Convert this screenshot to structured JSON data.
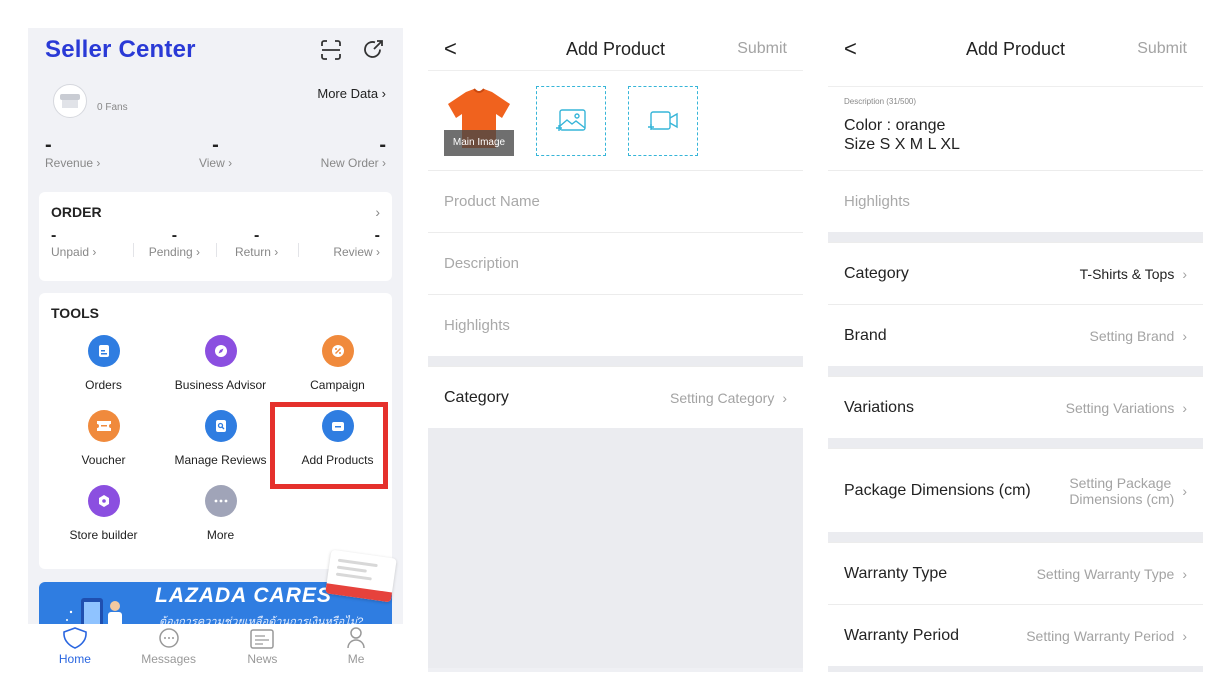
{
  "seller": {
    "title": "Seller Center",
    "fans": "0 Fans",
    "more_data": "More Data ›",
    "stats": [
      {
        "value": "-",
        "label": "Revenue ›"
      },
      {
        "value": "-",
        "label": "View ›"
      },
      {
        "value": "-",
        "label": "New Order ›"
      }
    ],
    "order": {
      "title": "ORDER",
      "chevron": "›",
      "items": [
        {
          "value": "-",
          "label": "Unpaid ›"
        },
        {
          "value": "-",
          "label": "Pending ›"
        },
        {
          "value": "-",
          "label": "Return ›"
        },
        {
          "value": "-",
          "label": "Review ›"
        }
      ]
    },
    "tools": {
      "title": "TOOLS",
      "items": [
        {
          "label": "Orders",
          "icon": "orders-icon",
          "color": "#2f7de1"
        },
        {
          "label": "Business Advisor",
          "icon": "compass-icon",
          "color": "#8b4fe0"
        },
        {
          "label": "Campaign",
          "icon": "percent-icon",
          "color": "#f08a3c"
        },
        {
          "label": "Voucher",
          "icon": "ticket-icon",
          "color": "#f08a3c"
        },
        {
          "label": "Manage Reviews",
          "icon": "review-icon",
          "color": "#2f7de1"
        },
        {
          "label": "Add Products",
          "icon": "box-icon",
          "color": "#2f7de1"
        },
        {
          "label": "Store builder",
          "icon": "store-builder-icon",
          "color": "#8b4fe0"
        },
        {
          "label": "More",
          "icon": "more-icon",
          "color": "#a0a4b8"
        }
      ]
    },
    "banner": {
      "title": "LAZADA CARES",
      "subtitle": "ต้องการความช่วยเหลือด้านการเงินหรือไม่?"
    },
    "tabs": [
      {
        "label": "Home",
        "icon": "home-icon",
        "active": true
      },
      {
        "label": "Messages",
        "icon": "messages-icon",
        "active": false
      },
      {
        "label": "News",
        "icon": "news-icon",
        "active": false
      },
      {
        "label": "Me",
        "icon": "me-icon",
        "active": false
      }
    ]
  },
  "add_product_1": {
    "back": "<",
    "title": "Add Product",
    "submit": "Submit",
    "main_image_label": "Main Image",
    "fields": {
      "name_placeholder": "Product Name",
      "description_placeholder": "Description",
      "highlights_placeholder": "Highlights"
    },
    "category": {
      "label": "Category",
      "value": "Setting Category"
    }
  },
  "add_product_2": {
    "back": "<",
    "title": "Add Product",
    "submit": "Submit",
    "description_label": "Description (31/500)",
    "description_line1": "Color : orange",
    "description_line2": "Size S X M L XL",
    "highlights_placeholder": "Highlights",
    "rows": {
      "category": {
        "label": "Category",
        "value": "T-Shirts & Tops"
      },
      "brand": {
        "label": "Brand",
        "value": "Setting Brand"
      },
      "variations": {
        "label": "Variations",
        "value": "Setting Variations"
      },
      "package": {
        "label": "Package Dimensions (cm)",
        "value_line1": "Setting Package",
        "value_line2": "Dimensions (cm)"
      },
      "warranty_type": {
        "label": "Warranty Type",
        "value": "Setting Warranty Type"
      },
      "warranty_period": {
        "label": "Warranty Period",
        "value": "Setting Warranty Period"
      }
    },
    "arrow": "›"
  }
}
